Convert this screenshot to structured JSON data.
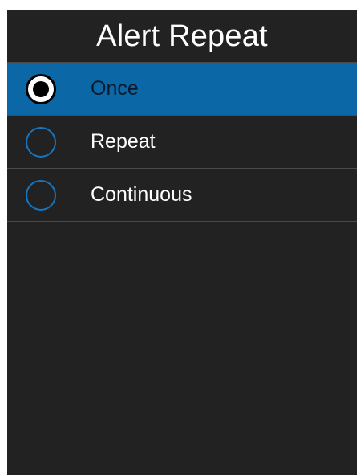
{
  "header": {
    "title": "Alert Repeat"
  },
  "options": [
    {
      "label": "Once",
      "selected": true
    },
    {
      "label": "Repeat",
      "selected": false
    },
    {
      "label": "Continuous",
      "selected": false
    }
  ],
  "colors": {
    "background": "#222222",
    "highlight": "#0b67a6",
    "radio_ring": "#1675bf",
    "divider": "#4a4a4a",
    "text": "#ffffff",
    "selected_text": "#0b1a2b"
  },
  "icons": {
    "radio_selected": "radio-selected-icon",
    "radio_unselected": "radio-unselected-icon"
  }
}
